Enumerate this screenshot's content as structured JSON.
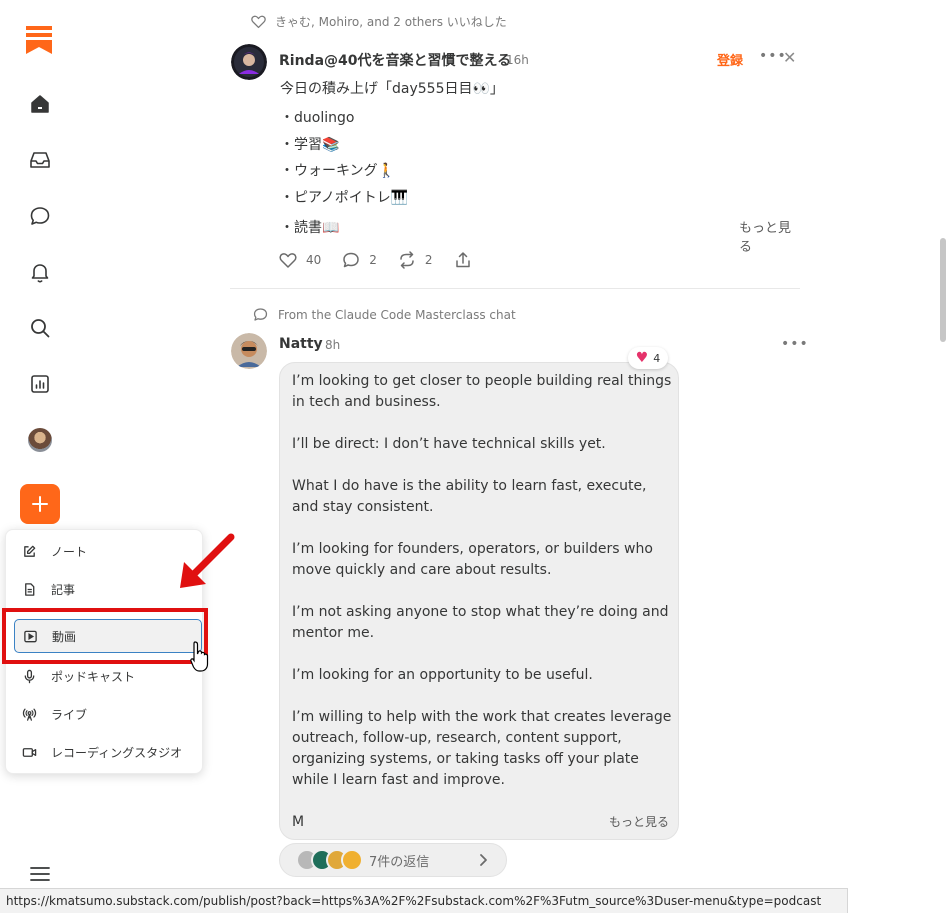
{
  "colors": {
    "brand": "#ff6719",
    "text": "#363737",
    "muted": "#7a7a7a",
    "heart": "#e5336b",
    "annotation_red": "#e01010"
  },
  "sidebar": {
    "items": [
      {
        "icon": "home-icon"
      },
      {
        "icon": "inbox-icon"
      },
      {
        "icon": "chat-icon"
      },
      {
        "icon": "bell-icon"
      },
      {
        "icon": "search-icon"
      },
      {
        "icon": "dashboard-icon"
      },
      {
        "icon": "profile-avatar"
      }
    ],
    "compose_icon": "plus-icon"
  },
  "compose_menu": {
    "items": [
      {
        "label": "ノート",
        "icon": "pencil-square-icon"
      },
      {
        "label": "記事",
        "icon": "document-icon"
      },
      {
        "label": "動画",
        "icon": "video-play-icon",
        "hovered": true
      },
      {
        "label": "ポッドキャスト",
        "icon": "microphone-icon"
      },
      {
        "label": "ライブ",
        "icon": "broadcast-icon"
      },
      {
        "label": "レコーディングスタジオ",
        "icon": "camera-icon"
      }
    ]
  },
  "post1": {
    "liked_by": "きゃむ, Mohiro, and 2 others いいねした",
    "author": "Rinda@40代を音楽と習慣で整える",
    "time": "16h",
    "subscribe_label": "登録",
    "lines": [
      "今日の積み上げ「day555日目👀」",
      "・duolingo",
      "・学習📚",
      "・ウォーキング🚶",
      "・ピアノポイトレ🎹",
      "・読書📖"
    ],
    "more_label": "もっと見る",
    "likes": "40",
    "comments": "2",
    "restacks": "2"
  },
  "post2": {
    "source": "From the Claude Code Masterclass chat",
    "author": "Natty",
    "time": "8h",
    "reaction_count": "4",
    "paragraphs": [
      "I’m looking to get closer to people building real things in tech and business.",
      "I’ll be direct: I don’t have technical skills yet.",
      "What I do have is the ability to learn fast, execute, and stay consistent.",
      "I’m looking for founders, operators, or builders who move quickly and care about results.",
      "I’m not asking anyone to stop what they’re doing and mentor me.",
      "I’m looking for an opportunity to be useful.",
      "I’m willing to help with the work that creates leverage outreach, follow-up, research, content support, organizing systems, or taking tasks off your plate while I learn fast and improve.",
      "M"
    ],
    "more_label": "もっと見る",
    "replies_label": "7件の返信"
  },
  "status_url": "https://kmatsumo.substack.com/publish/post?back=https%3A%2F%2Fsubstack.com%2F%3Futm_source%3Duser-menu&type=podcast"
}
